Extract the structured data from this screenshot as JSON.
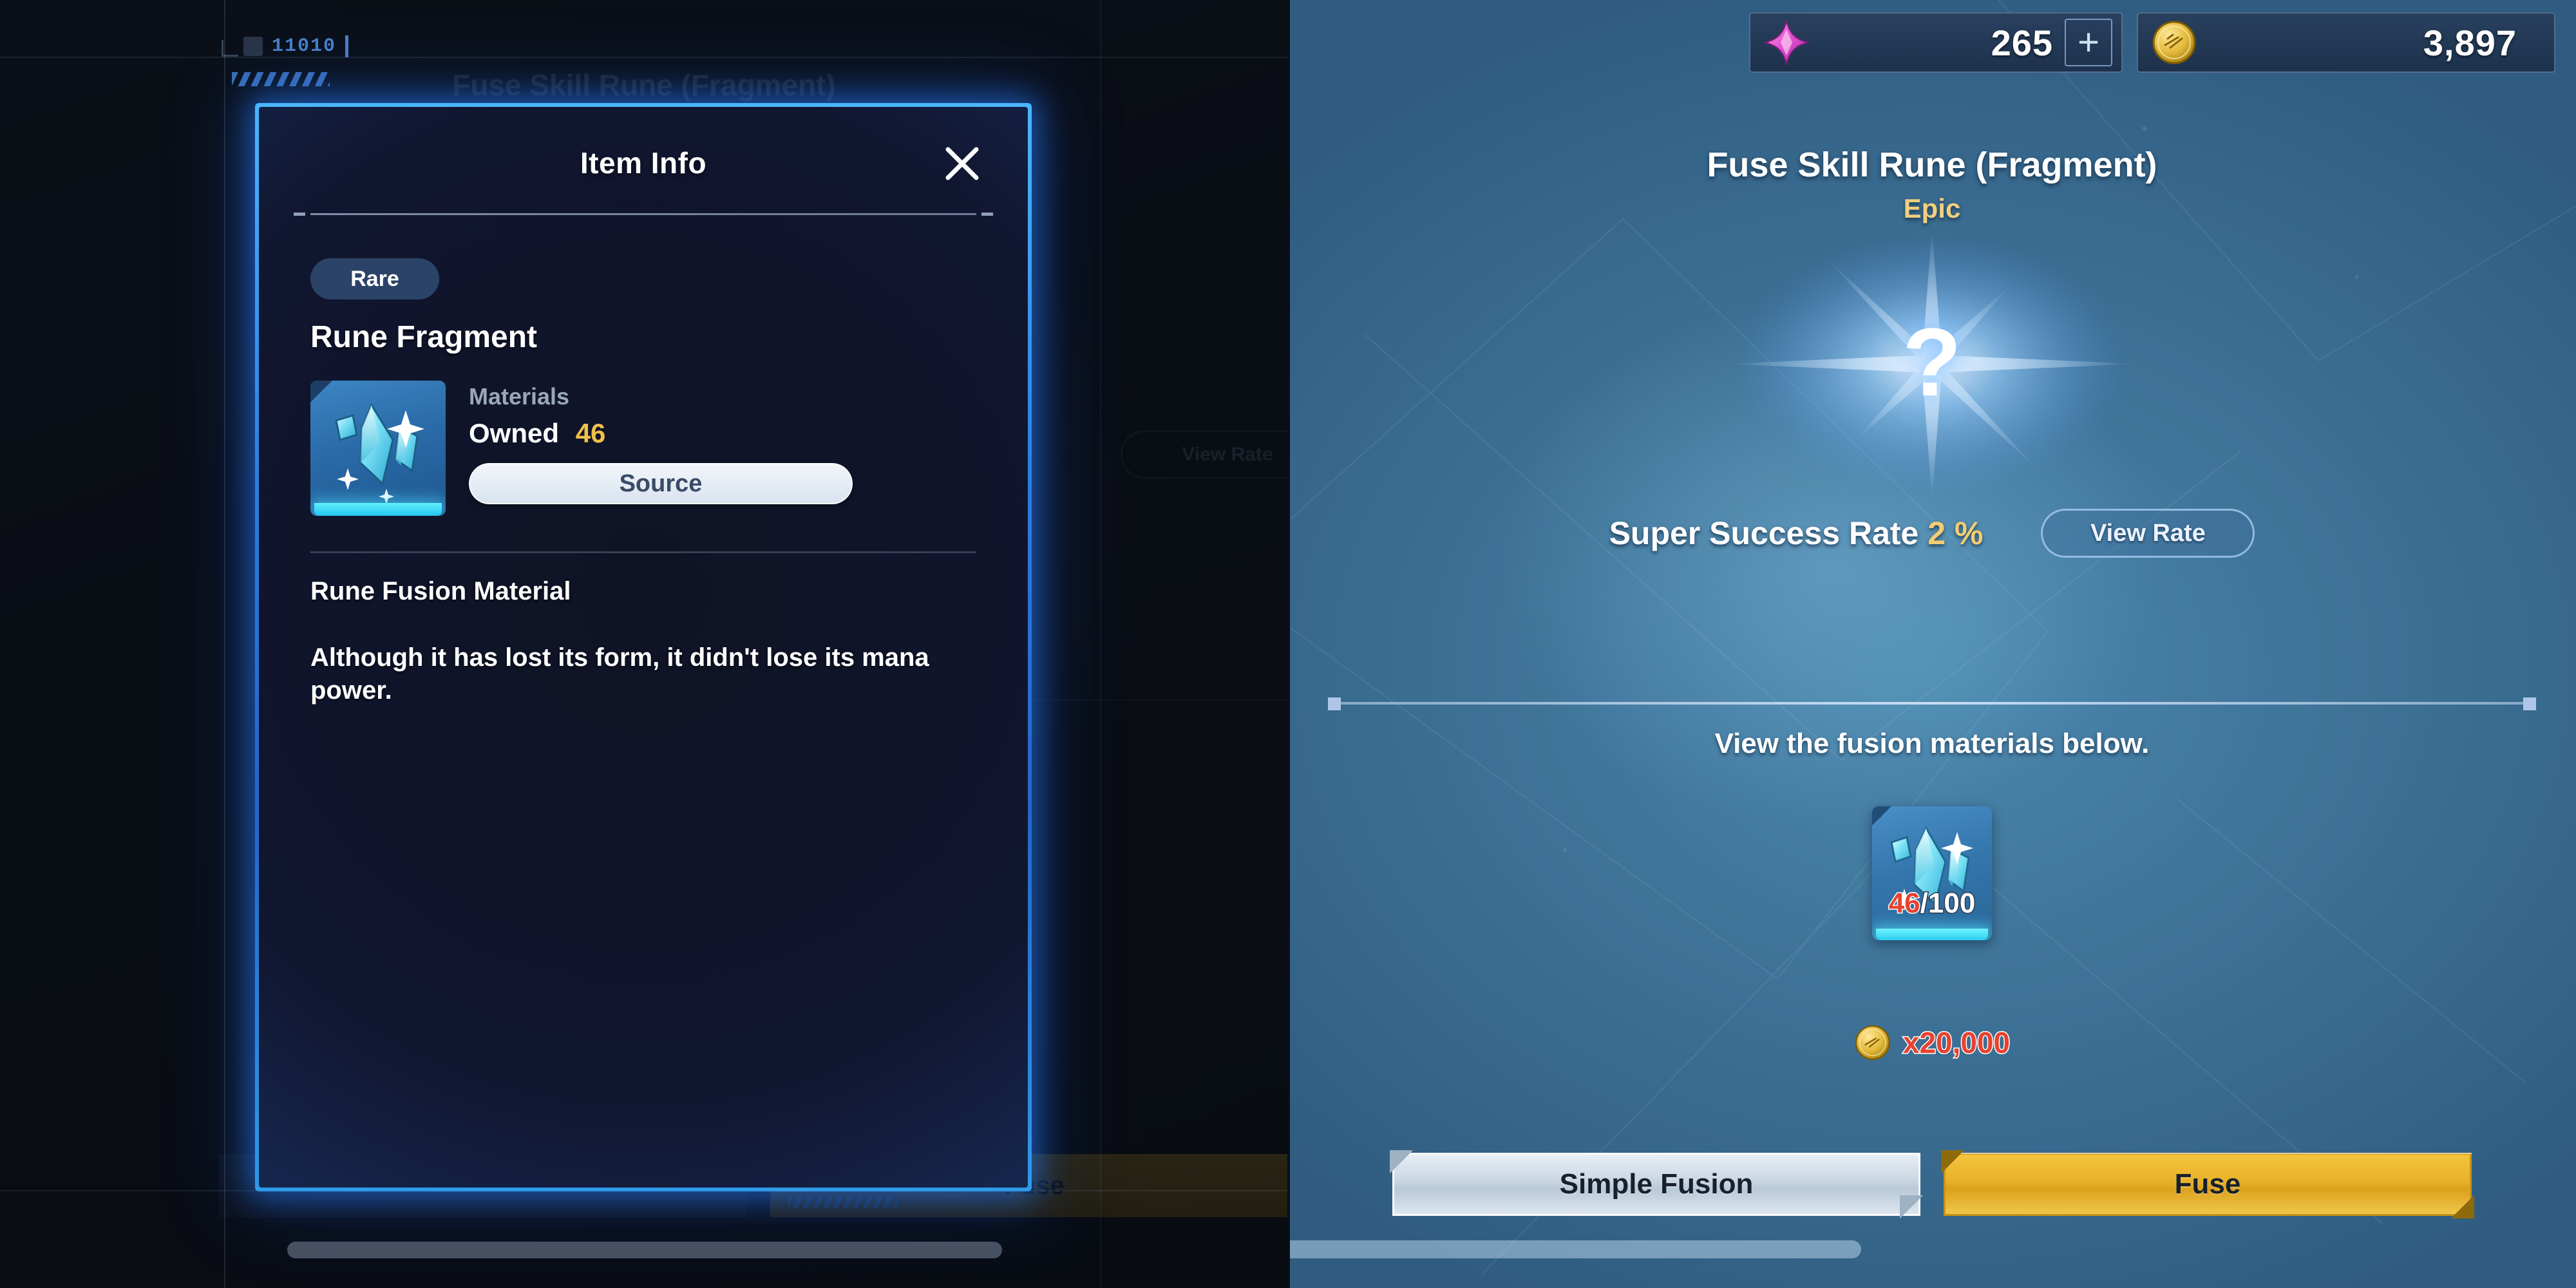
{
  "modal": {
    "title": "Item Info",
    "close_icon": "close-icon",
    "rarity": "Rare",
    "item_name": "Rune Fragment",
    "item_icon": "rune-fragment-crystal-icon",
    "materials_label": "Materials",
    "owned_label": "Owned",
    "owned_count": "46",
    "source_button": "Source",
    "desc_title": "Rune Fusion Material",
    "desc_body": "Although it has lost its form, it didn't lose its mana power."
  },
  "background_hud": {
    "marker_text": "11010"
  },
  "fusion": {
    "topbar": {
      "gem_icon": "gem-currency-icon",
      "gem_value": "265",
      "add_label": "+",
      "gold_icon": "gold-coin-icon",
      "gold_value": "3,897"
    },
    "title": "Fuse Skill Rune (Fragment)",
    "subtitle": "Epic",
    "result_icon": "unknown-question-mark-icon",
    "result_placeholder": "?",
    "rate_label": "Super Success Rate",
    "rate_value": "2 %",
    "view_rate_button": "View Rate",
    "materials_note": "View the fusion materials below.",
    "material": {
      "icon": "rune-fragment-crystal-icon",
      "have": "46",
      "need": "/100"
    },
    "cost": {
      "icon": "gold-coin-icon",
      "amount": "x20,000"
    },
    "buttons": {
      "simple": "Simple Fusion",
      "fuse": "Fuse"
    }
  },
  "colors": {
    "accent_blue": "#2b7de0",
    "glow_cyan": "#4ab6ff",
    "gold": "#f0c04a",
    "epic_gold": "#f0cf7e",
    "insufficient_red": "#e8422e",
    "panel_blue": "#3d7095",
    "modal_dark": "#111630"
  }
}
